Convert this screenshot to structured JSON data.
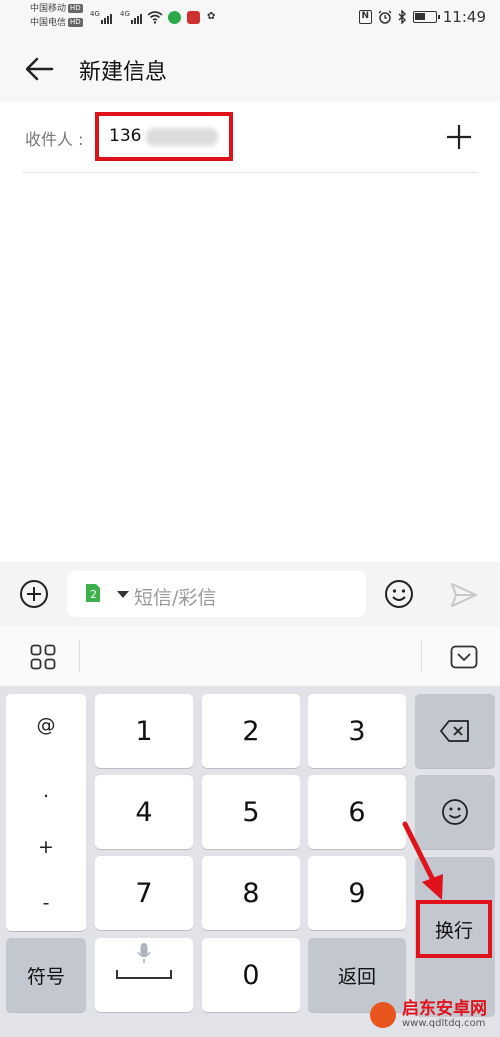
{
  "status_bar": {
    "carrier_1": "中国移动",
    "carrier_2": "中国电信",
    "hd": "HD",
    "network": "4G",
    "time": "11:49",
    "nfc": "N"
  },
  "header": {
    "title": "新建信息"
  },
  "recipient": {
    "label": "收件人 :",
    "number": "136"
  },
  "compose": {
    "sim_slot": "2",
    "placeholder": "短信/彩信"
  },
  "keyboard": {
    "side_symbols": [
      "@",
      ".",
      "+",
      "-"
    ],
    "digits": [
      "1",
      "2",
      "3",
      "4",
      "5",
      "6",
      "7",
      "8",
      "9",
      "0"
    ],
    "symbol_key": "符号",
    "return_key": "返回",
    "enter_key": "换行"
  },
  "watermark": {
    "name": "启东安卓网",
    "url": "www.qdltdq.com"
  },
  "colors": {
    "highlight": "#e0121c",
    "keyboard_bg": "#e1e3e8",
    "dark_key": "#c2c7d0"
  }
}
